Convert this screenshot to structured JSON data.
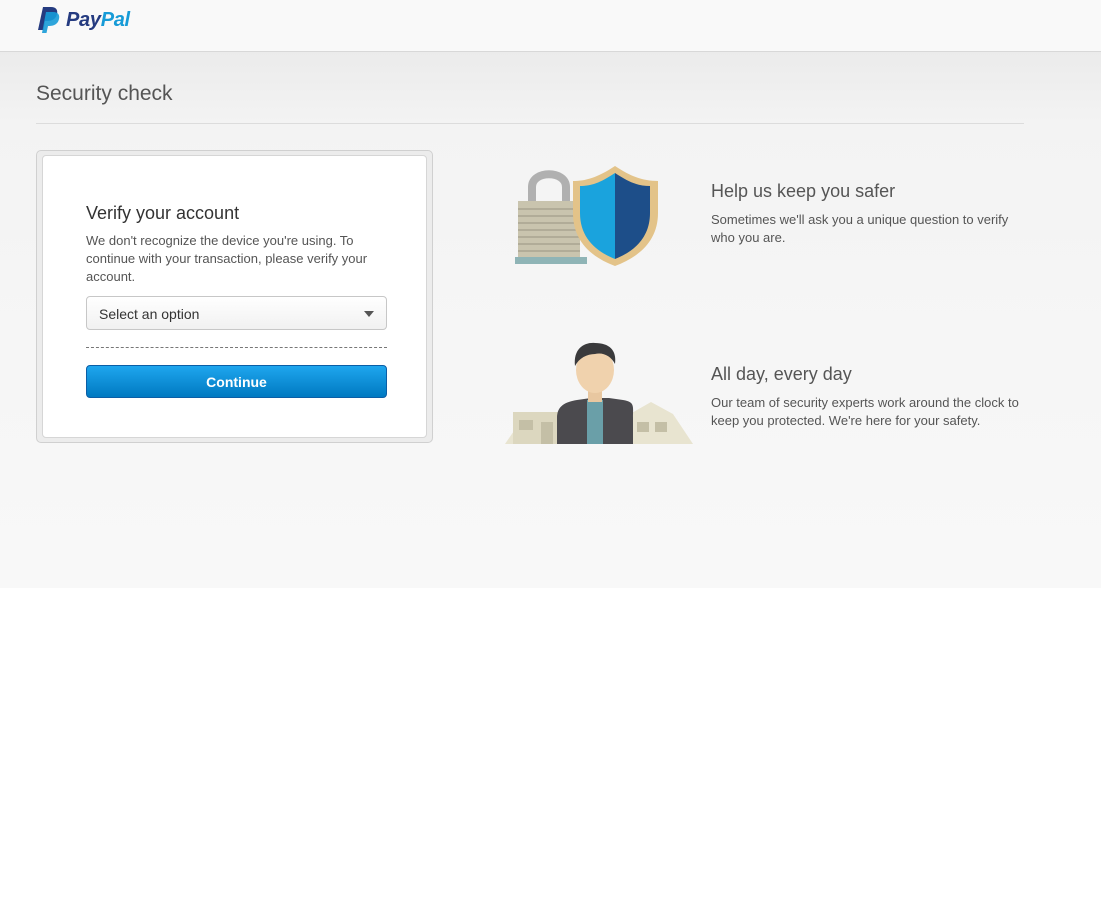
{
  "header": {
    "logo": {
      "part1": "Pay",
      "part2": "Pal"
    }
  },
  "page": {
    "title": "Security check"
  },
  "verify_card": {
    "title": "Verify your account",
    "description": "We don't recognize the device you're using. To continue with your transaction, please verify your account.",
    "select": {
      "selected_label": "Select an option"
    },
    "continue_label": "Continue"
  },
  "features": [
    {
      "icon": "lock-shield-icon",
      "title": "Help us keep you safer",
      "description": "Sometimes we'll ask you a unique question to verify who you are."
    },
    {
      "icon": "security-expert-icon",
      "title": "All day, every day",
      "description": "Our team of security experts work around the clock to keep you protected. We're here for your safety."
    }
  ],
  "colors": {
    "brand_dark_blue": "#253b80",
    "brand_light_blue": "#179bd7",
    "button_blue": "#0079c1"
  }
}
